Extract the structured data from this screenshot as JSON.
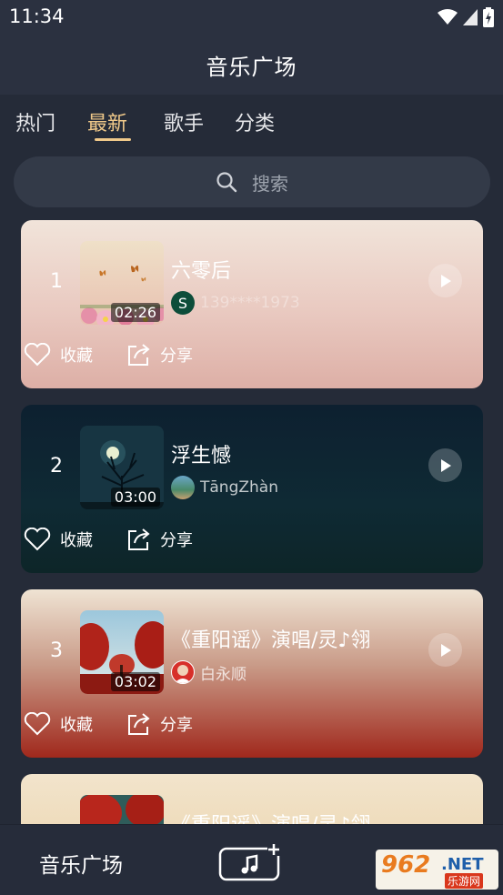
{
  "status_bar": {
    "time": "11:34"
  },
  "header": {
    "title": "音乐广场"
  },
  "tabs": [
    {
      "label": "热门",
      "active": false
    },
    {
      "label": "最新",
      "active": true
    },
    {
      "label": "歌手",
      "active": false
    },
    {
      "label": "分类",
      "active": false
    }
  ],
  "search": {
    "placeholder": "搜索"
  },
  "songs": [
    {
      "rank": "1",
      "title": "六零后",
      "duration": "02:26",
      "uploader": "139****1973",
      "avatar_letter": "S"
    },
    {
      "rank": "2",
      "title": "浮生憾",
      "duration": "03:00",
      "uploader": "TāngZhàn"
    },
    {
      "rank": "3",
      "title": "《重阳谣》演唱/灵♪翎",
      "duration": "03:02",
      "uploader": "白永顺"
    },
    {
      "rank": "",
      "title": "《重阳谣》演唱/灵♪翎"
    }
  ],
  "actions": {
    "favorite": "收藏",
    "share": "分享"
  },
  "bottom_nav": {
    "label": "音乐广场"
  },
  "watermark": {
    "number": "962",
    "net": ".NET",
    "sub": "乐游网"
  },
  "colors": {
    "accent": "#f0c98a",
    "background": "#252b38"
  },
  "icons": [
    "wifi-icon",
    "signal-icon",
    "battery-icon",
    "search-icon",
    "play-icon",
    "heart-icon",
    "share-icon",
    "add-music-icon"
  ]
}
